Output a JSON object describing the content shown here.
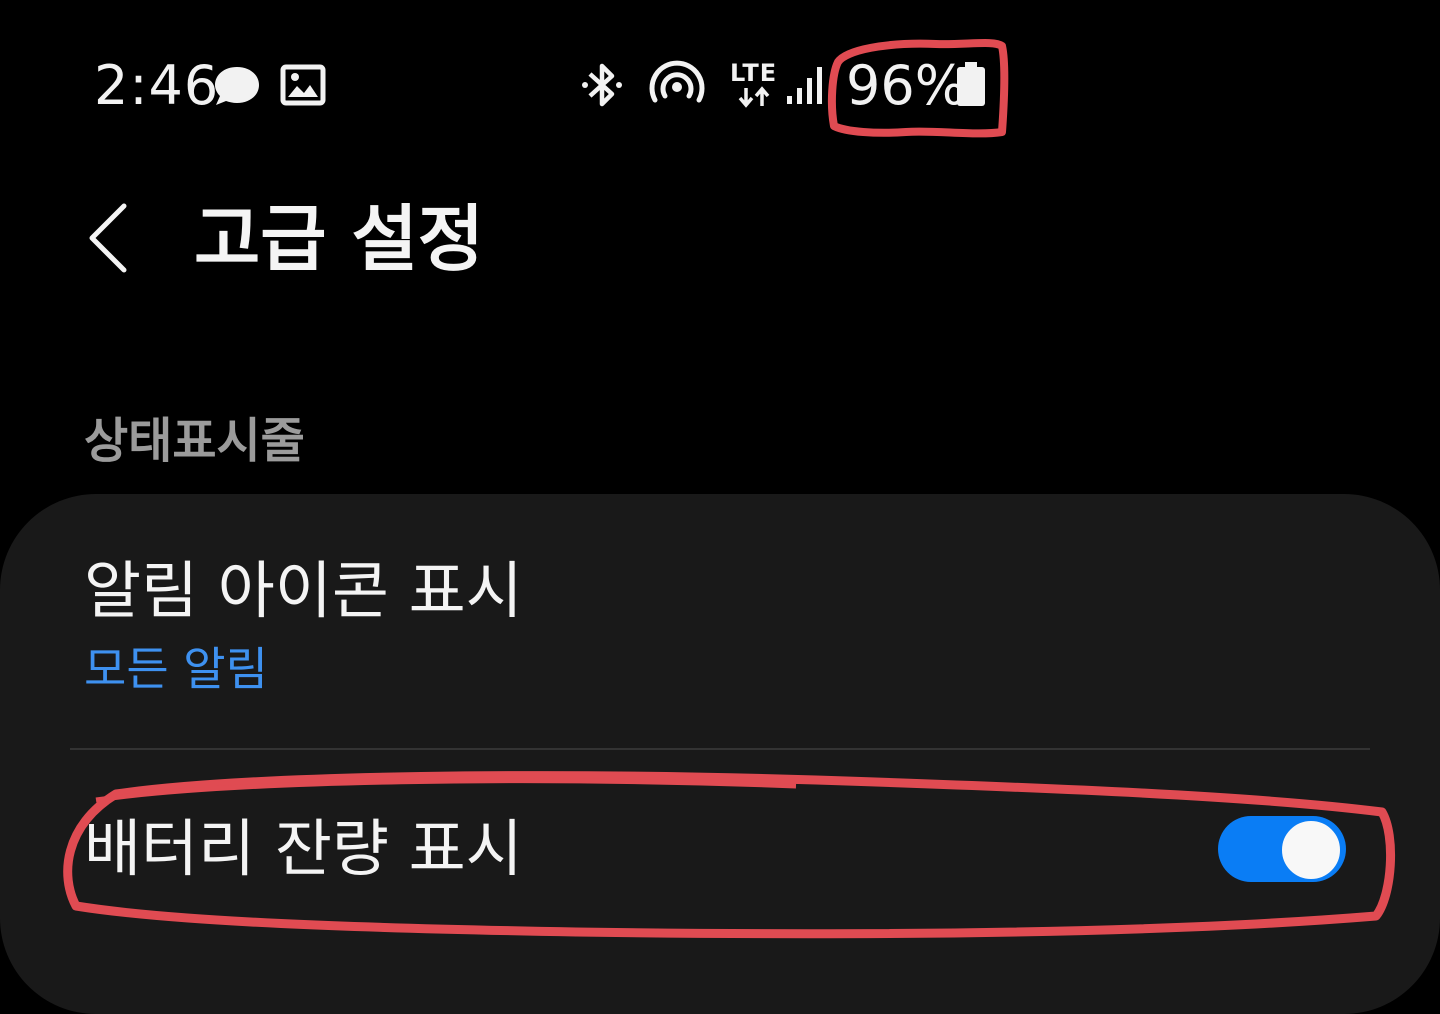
{
  "status_bar": {
    "time": "2:46",
    "network_label": "LTE",
    "battery_percent": "96%",
    "icons": [
      "chat-bubble-icon",
      "image-icon",
      "bluetooth-icon",
      "hotspot-icon",
      "lte-data-icon",
      "signal-icon",
      "battery-icon"
    ]
  },
  "header": {
    "title": "고급 설정"
  },
  "section": {
    "title": "상태표시줄"
  },
  "settings": {
    "notification_icons": {
      "title": "알림 아이콘 표시",
      "value": "모든 알림"
    },
    "battery_percentage": {
      "title": "배터리 잔량 표시",
      "enabled": true
    }
  },
  "colors": {
    "background": "#000000",
    "card": "#191919",
    "accent": "#0a7df5",
    "link": "#3e91f0",
    "section_header": "#9b9b9b",
    "annotation": "#e04b52"
  }
}
